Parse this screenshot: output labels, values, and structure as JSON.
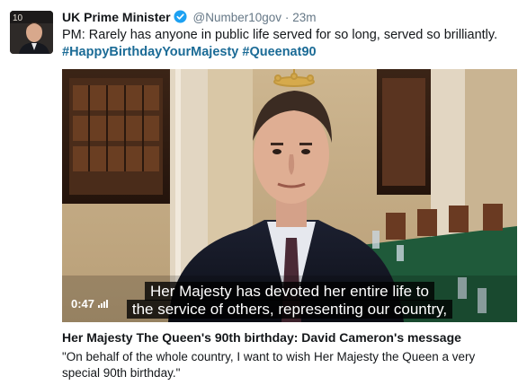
{
  "tweet": {
    "author_name": "UK Prime Minister",
    "handle": "@Number10gov",
    "separator": "·",
    "time": "23m",
    "text": "PM: Rarely has anyone in public life served for so long, served so brilliantly.",
    "hashtags": [
      "#HappyBirthdayYourMajesty",
      "#Queenat90"
    ]
  },
  "avatar": {
    "door_number": "10"
  },
  "media": {
    "duration": "0:47",
    "subtitle_lines": [
      "Her Majesty has devoted her entire life to",
      "the service of others, representing our country,"
    ]
  },
  "card": {
    "title": "Her Majesty The Queen's 90th birthday: David Cameron's message",
    "description": "\"On behalf of the whole country, I want to wish Her Majesty the Queen a very special 90th birthday.\""
  },
  "colors": {
    "hashtag": "#1b6b96",
    "verified": "#1da1f2",
    "meta": "#657786"
  }
}
